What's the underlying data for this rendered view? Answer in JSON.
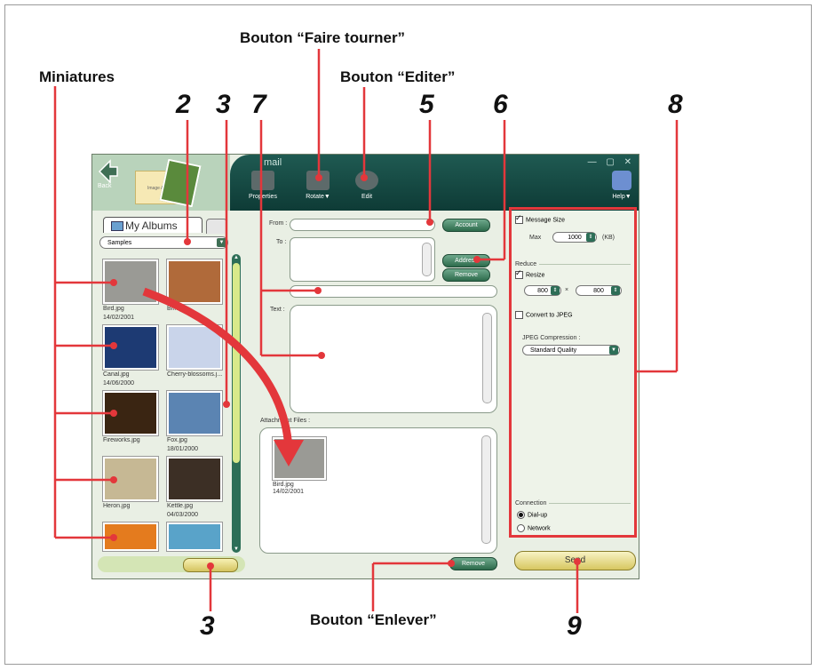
{
  "callouts": {
    "rotate_button": "Bouton “Faire tourner”",
    "edit_button": "Bouton “Editer”",
    "thumbnails": "Miniatures",
    "remove_button": "Bouton “Enlever”"
  },
  "numbers": {
    "n2": "2",
    "n3a": "3",
    "n7": "7",
    "n5": "5",
    "n6": "6",
    "n8": "8",
    "n3b": "3",
    "n9": "9"
  },
  "window": {
    "title": "mail",
    "back_label": "Back",
    "album_note": "Image Album Save",
    "toolbar": [
      {
        "label": "Properties",
        "icon": "properties-icon"
      },
      {
        "label": "Rotate▼",
        "icon": "rotate-icon"
      },
      {
        "label": "Edit",
        "icon": "edit-icon"
      }
    ],
    "help_label": "Help▼"
  },
  "left": {
    "tab_label": "My Albums",
    "album_select": "Samples",
    "thumbnails": [
      {
        "name": "Bird.jpg",
        "date": "14/02/2001",
        "color": "#9a9a95"
      },
      {
        "name": "Bri...jpg",
        "date": "",
        "color": "#b06a3a"
      },
      {
        "name": "Canal.jpg",
        "date": "14/06/2000",
        "color": "#1d3a73"
      },
      {
        "name": "Cherry-blossoms.j...",
        "date": "",
        "color": "#c9d4ea"
      },
      {
        "name": "Fireworks.jpg",
        "date": "",
        "color": "#3a2512"
      },
      {
        "name": "Fox.jpg",
        "date": "18/01/2000",
        "color": "#5b84b2"
      },
      {
        "name": "Heron.jpg",
        "date": "",
        "color": "#c6b894"
      },
      {
        "name": "Kettle.jpg",
        "date": "04/03/2000",
        "color": "#3c2f25"
      },
      {
        "name": "",
        "date": "",
        "color": "#e47b1e"
      },
      {
        "name": "",
        "date": "",
        "color": "#59a3c9"
      }
    ]
  },
  "form": {
    "from_label": "From :",
    "to_label": "To :",
    "text_label": "Text :",
    "attachments_label": "Attachment Files :",
    "account_button": "Account",
    "address_button": "Address",
    "remove_button": "Remove",
    "attachments_remove": "Remove",
    "attachment": {
      "name": "Bird.jpg",
      "date": "14/02/2001"
    }
  },
  "settings": {
    "message_size_label": "Message Size",
    "max_label": "Max",
    "max_value": "1000",
    "max_unit": "(KB)",
    "reduce_label": "Reduce",
    "resize_label": "Resize",
    "width": "800",
    "height": "800",
    "times": "×",
    "convert_label": "Convert to JPEG",
    "jpeg_label": "JPEG Compression :",
    "jpeg_value": "Standard Quality",
    "connection_label": "Connection",
    "dialup_label": "Dial-up",
    "network_label": "Network"
  },
  "send_label": "Send",
  "colors": {
    "accent_red": "#e3373b",
    "titlebar": "#1f5a52",
    "scroll_green": "#2d6e57"
  }
}
